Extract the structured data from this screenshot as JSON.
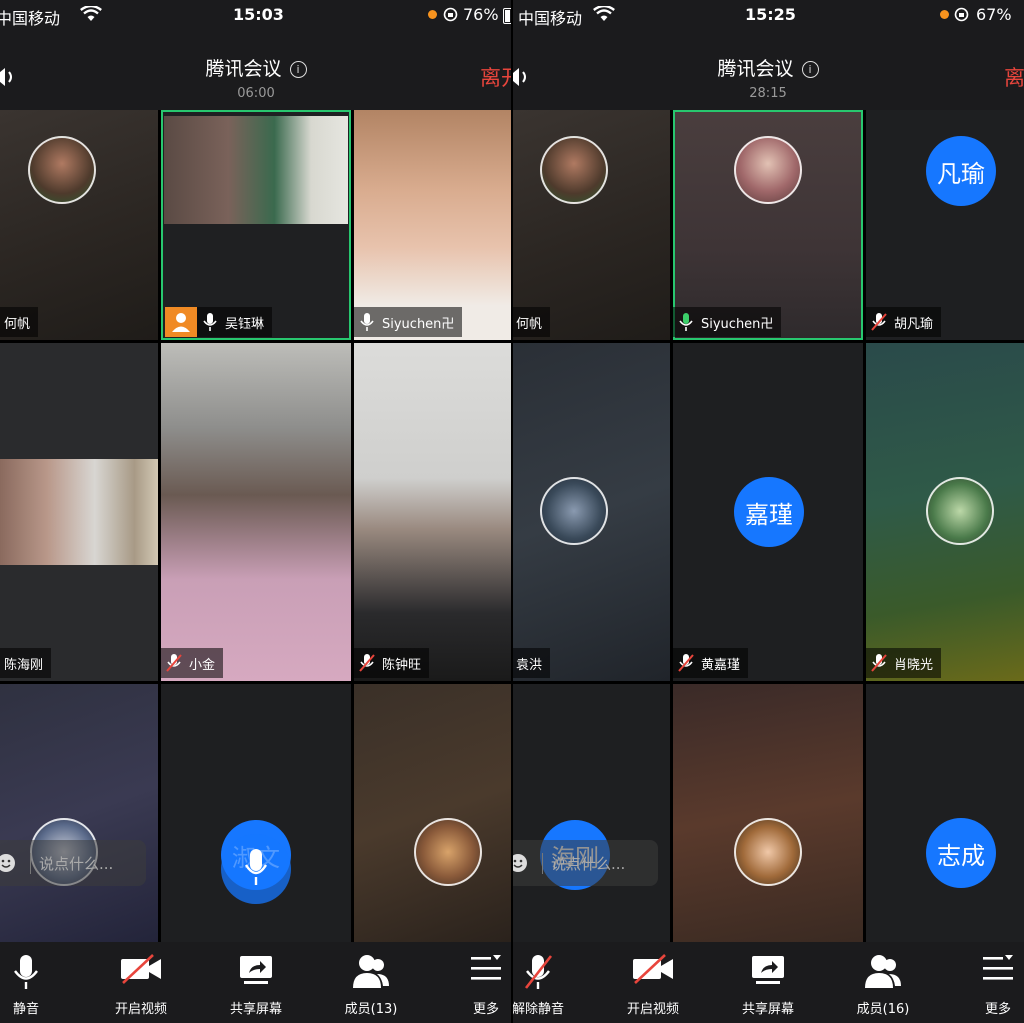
{
  "left": {
    "status": {
      "carrier": "中国移动",
      "time": "15:03",
      "battery": "76%"
    },
    "header": {
      "title": "腾讯会议",
      "timer": "06:00",
      "leave": "离开"
    },
    "tiles": [
      {
        "name": "何帆"
      },
      {
        "name": "吴钰琳"
      },
      {
        "name": "Siyuchen卍"
      },
      {
        "name": "陈海刚"
      },
      {
        "name": "小金"
      },
      {
        "name": "陈钟旺"
      },
      {
        "avatar_text": "淑文"
      }
    ],
    "chat_placeholder": "说点什么...",
    "toolbar": {
      "mute": "静音",
      "video": "开启视频",
      "share": "共享屏幕",
      "members": "成员(13)",
      "more": "更多"
    }
  },
  "right": {
    "status": {
      "carrier": "中国移动",
      "time": "15:25",
      "battery": "67%"
    },
    "header": {
      "title": "腾讯会议",
      "timer": "28:15",
      "leave": "离开"
    },
    "tiles": [
      {
        "name": "何帆"
      },
      {
        "name": "Siyuchen卍"
      },
      {
        "name": "胡凡瑜",
        "avatar_text": "凡瑜"
      },
      {
        "name": "袁洪"
      },
      {
        "name": "黄嘉瑾",
        "avatar_text": "嘉瑾"
      },
      {
        "name": "肖晓光"
      },
      {
        "avatar_text": "海刚"
      },
      {},
      {
        "avatar_text": "志成"
      }
    ],
    "chat_placeholder": "说点什么...",
    "toolbar": {
      "mute": "解除静音",
      "video": "开启视频",
      "share": "共享屏幕",
      "members": "成员(16)",
      "more": "更多"
    }
  },
  "colors": {
    "accent": "#1677ff",
    "active_border": "#28c76f",
    "leave": "#e8453c",
    "bar_bg": "#1b1b1d"
  }
}
